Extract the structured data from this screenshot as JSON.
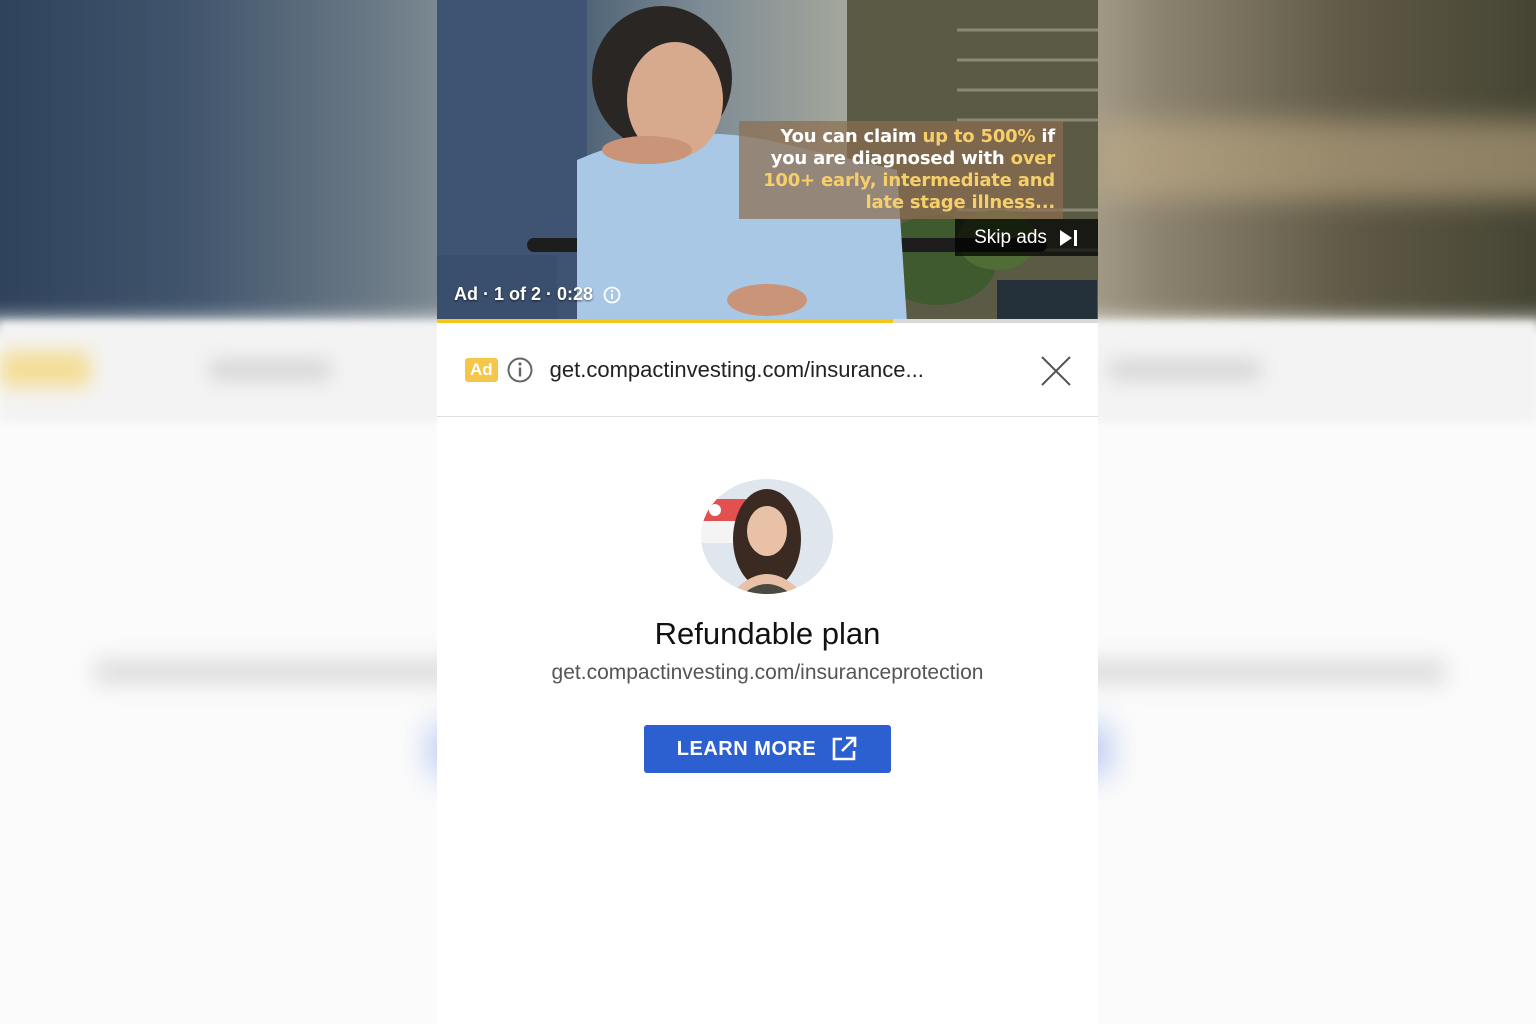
{
  "video": {
    "caption_parts": [
      "You can claim ",
      "up to 500%",
      " if you are diagnosed with ",
      "over 100+ early, intermediate and late stage illness..."
    ],
    "skip_label": "Skip ads",
    "ad_meta": "Ad · 1 of 2 · 0:28",
    "progress_fraction": 0.69,
    "progress_color": "#f5c518"
  },
  "ad_bar": {
    "badge": "Ad",
    "url": "get.compactinvesting.com/insurance..."
  },
  "card": {
    "title": "Refundable plan",
    "url": "get.compactinvesting.com/insuranceprotection",
    "cta_label": "LEARN MORE",
    "cta_color": "#2c5fcf"
  },
  "icons": {
    "info": "info-icon",
    "close": "close-icon",
    "skip": "skip-next-icon",
    "external": "external-link-icon"
  }
}
